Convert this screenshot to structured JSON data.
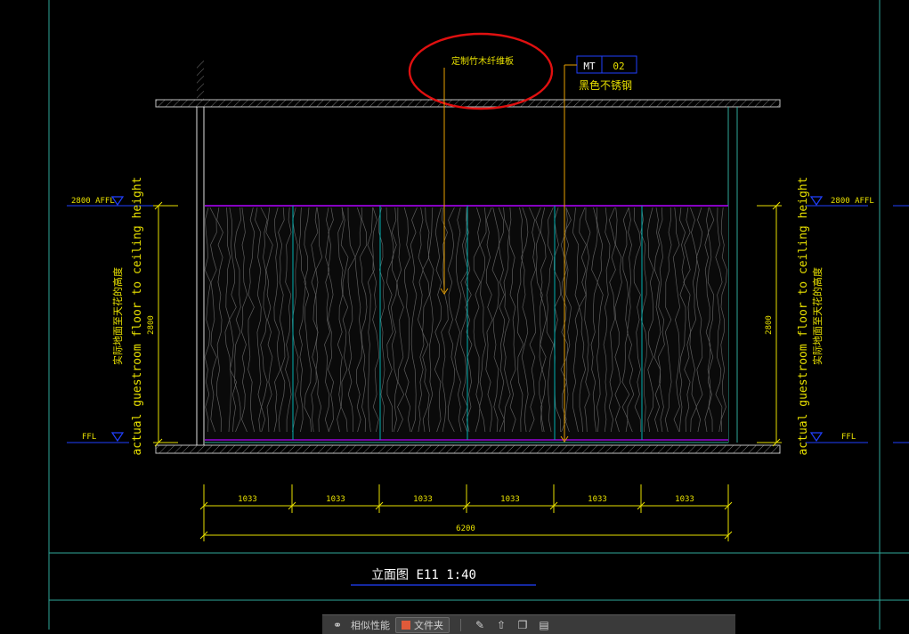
{
  "drawing": {
    "material_callout": "定制竹木纤维板",
    "tag_code": "MT",
    "tag_number": "02",
    "tag_description": "黑色不锈钢",
    "level_top": "2800 AFFL",
    "level_bottom": "FFL",
    "height_dimension": "2800",
    "vertical_note_en": "actual guestroom floor to ceiling height",
    "vertical_note_cn": "实际地面至天花的高度",
    "segment_dims": [
      "1033",
      "1033",
      "1033",
      "1033",
      "1033",
      "1033"
    ],
    "total_dim": "6200",
    "view_title": "立面图 E11 1:40"
  },
  "toolbar": {
    "left_label": "相似性能",
    "tab_label": "文件夹"
  },
  "colors": {
    "background": "#000000",
    "dimension": "#e8e000",
    "panel_seam": "#00b0b0",
    "ceiling_line": "#b000ff",
    "frame": "#2fa89a",
    "title_underline": "#2040ff",
    "callout_circle": "#e01010",
    "tag_box": "#2040ff"
  }
}
